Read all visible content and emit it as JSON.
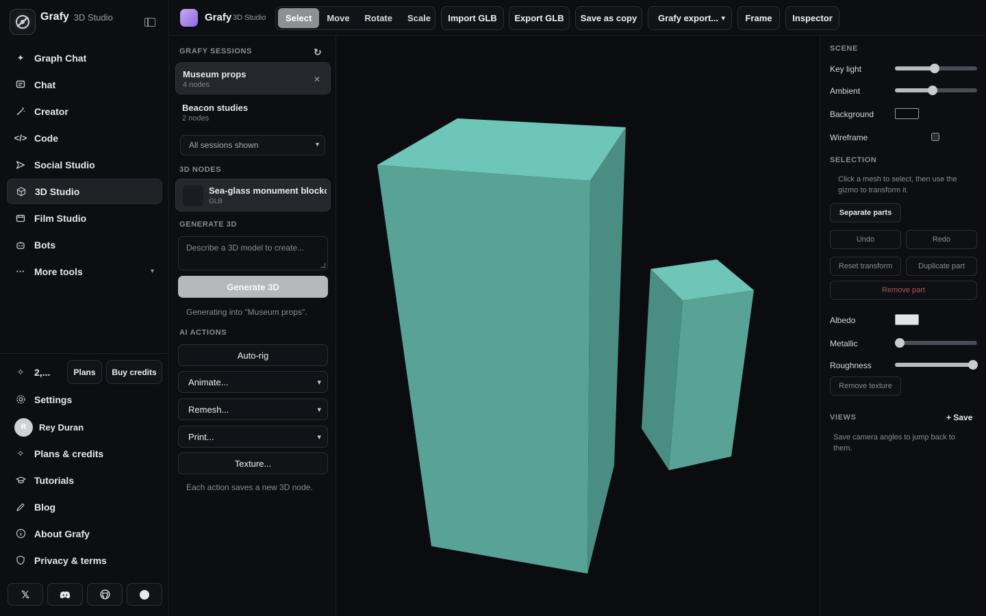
{
  "app": {
    "name": "Grafy",
    "subtitle": "3D Studio"
  },
  "sidebar": {
    "items": [
      {
        "label": "Graph Chat",
        "icon": "sparkle-icon"
      },
      {
        "label": "Chat",
        "icon": "chat-icon"
      },
      {
        "label": "Creator",
        "icon": "wand-icon"
      },
      {
        "label": "Code",
        "icon": "code-icon"
      },
      {
        "label": "Social Studio",
        "icon": "send-icon"
      },
      {
        "label": "3D Studio",
        "icon": "cube-icon",
        "active": true
      },
      {
        "label": "Film Studio",
        "icon": "film-icon"
      },
      {
        "label": "Bots",
        "icon": "bot-icon"
      },
      {
        "label": "More tools",
        "icon": "dots-icon"
      }
    ],
    "credits": "2,...",
    "plans_label": "Plans",
    "buy_credits_label": "Buy credits",
    "settings_label": "Settings",
    "user": {
      "initial": "R",
      "name": "Rey Duran"
    },
    "bottom_items": [
      {
        "label": "Plans & credits",
        "icon": "sparkle-icon"
      },
      {
        "label": "Tutorials",
        "icon": "graduation-cap-icon"
      },
      {
        "label": "Blog",
        "icon": "pen-icon"
      },
      {
        "label": "About Grafy",
        "icon": "info-icon"
      },
      {
        "label": "Privacy & terms",
        "icon": "shield-icon"
      }
    ],
    "socials": [
      {
        "label": "X",
        "icon": "x-icon"
      },
      {
        "label": "Discord",
        "icon": "discord-icon"
      },
      {
        "label": "GitHub",
        "icon": "github-icon"
      },
      {
        "label": "Other",
        "icon": "circle-icon"
      }
    ]
  },
  "toolbar": {
    "title": "Grafy",
    "subtitle": "3D Studio",
    "modes": [
      "Select",
      "Move",
      "Rotate",
      "Scale"
    ],
    "active_mode": "Select",
    "import_label": "Import GLB",
    "export_label": "Export GLB",
    "save_copy_label": "Save as copy",
    "grafy_export_label": "Grafy export...",
    "frame_label": "Frame",
    "inspector_label": "Inspector"
  },
  "panel": {
    "sessions_title": "GRAFY SESSIONS",
    "sessions": [
      {
        "name": "Museum props",
        "meta": "4 nodes",
        "active": true
      },
      {
        "name": "Beacon studies",
        "meta": "2 nodes",
        "active": false
      }
    ],
    "sessions_filter": "All sessions shown",
    "nodes_title": "3D NODES",
    "node": {
      "name": "Sea-glass monument blocko",
      "meta": "GLB"
    },
    "generate_title": "GENERATE 3D",
    "prompt_placeholder": "Describe a 3D model to create...",
    "generate_label": "Generate 3D",
    "generating_hint": "Generating into \"Museum props\".",
    "ai_title": "AI ACTIONS",
    "autorig_label": "Auto-rig",
    "animate_label": "Animate...",
    "remesh_label": "Remesh...",
    "print_label": "Print...",
    "texture_label": "Texture...",
    "actions_hint": "Each action saves a new 3D node."
  },
  "inspector": {
    "scene_title": "SCENE",
    "key_light_label": "Key light",
    "key_light_value": 0.48,
    "ambient_label": "Ambient",
    "ambient_value": 0.46,
    "background_label": "Background",
    "background_color": "#0b0c10",
    "wireframe_label": "Wireframe",
    "selection_title": "SELECTION",
    "selection_help": "Click a mesh to select, then use the gizmo to transform it.",
    "separate_label": "Separate parts",
    "undo_label": "Undo",
    "redo_label": "Redo",
    "reset_label": "Reset transform",
    "duplicate_label": "Duplicate part",
    "remove_part_label": "Remove part",
    "albedo_label": "Albedo",
    "albedo_color": "#e4e4e6",
    "metallic_label": "Metallic",
    "metallic_value": 0.0,
    "roughness_label": "Roughness",
    "roughness_value": 0.95,
    "remove_texture_label": "Remove texture",
    "views_title": "VIEWS",
    "views_save": "+ Save",
    "views_help": "Save camera angles to jump back to them."
  },
  "colors": {
    "accent": "#9b7ef0",
    "mesh_top": "#6ec6b8",
    "mesh_front": "#58a396",
    "mesh_side": "#4a8d82"
  }
}
